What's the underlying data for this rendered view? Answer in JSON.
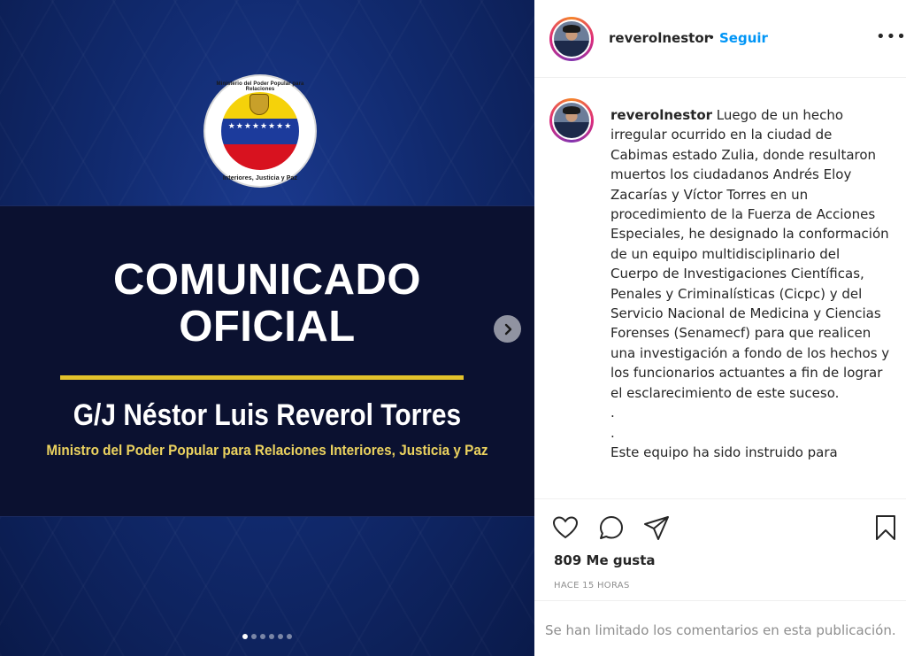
{
  "post_image": {
    "seal_text_top": "Ministerio del Poder Popular para Relaciones",
    "seal_text_bottom": "Interiores, Justicia y Paz",
    "seal_stars": "★★★★★★★★",
    "headline_line1": "COMUNICADO",
    "headline_line2": "OFICIAL",
    "minister_name": "G/J Néstor Luis Reverol Torres",
    "minister_role": "Ministro del Poder Popular para Relaciones Interiores, Justicia y Paz",
    "carousel": {
      "total_slides": 6,
      "active_slide": 1
    },
    "colors": {
      "background": "#112a6e",
      "band": "#0b1130",
      "rule": "#e3c22b",
      "role_text": "#ecd35f"
    }
  },
  "header": {
    "username": "reverolnestor",
    "separator": "•",
    "follow_label": "Seguir",
    "more_icon": "more-horizontal-icon"
  },
  "caption": {
    "username": "reverolnestor",
    "text": " Luego de un hecho irregular ocurrido en la ciudad de Cabimas estado Zulia, donde resultaron muertos los ciudadanos Andrés Eloy Zacarías y Víctor Torres en un procedimiento de la Fuerza de Acciones Especiales, he designado la conformación de un equipo multidisciplinario del Cuerpo de Investigaciones Científicas, Penales y Criminalísticas (Cicpc) y del Servicio Nacional de Medicina y Ciencias Forenses (Senamecf) para que realicen una investigación a fondo de los hechos y los funcionarios actuantes a fin de lograr el esclarecimiento de este suceso.\n.\n.\nEste equipo ha sido instruido para"
  },
  "actions": {
    "icons": [
      "heart-icon",
      "comment-icon",
      "share-icon",
      "bookmark-icon"
    ],
    "likes_text": "809 Me gusta",
    "time_text": "HACE 15 HORAS"
  },
  "comments": {
    "limited_text": "Se han limitado los comentarios en esta publicación."
  },
  "colors": {
    "accent": "#0095f6",
    "text": "#262626",
    "muted": "#8e8e8e",
    "divider": "#efefef"
  }
}
